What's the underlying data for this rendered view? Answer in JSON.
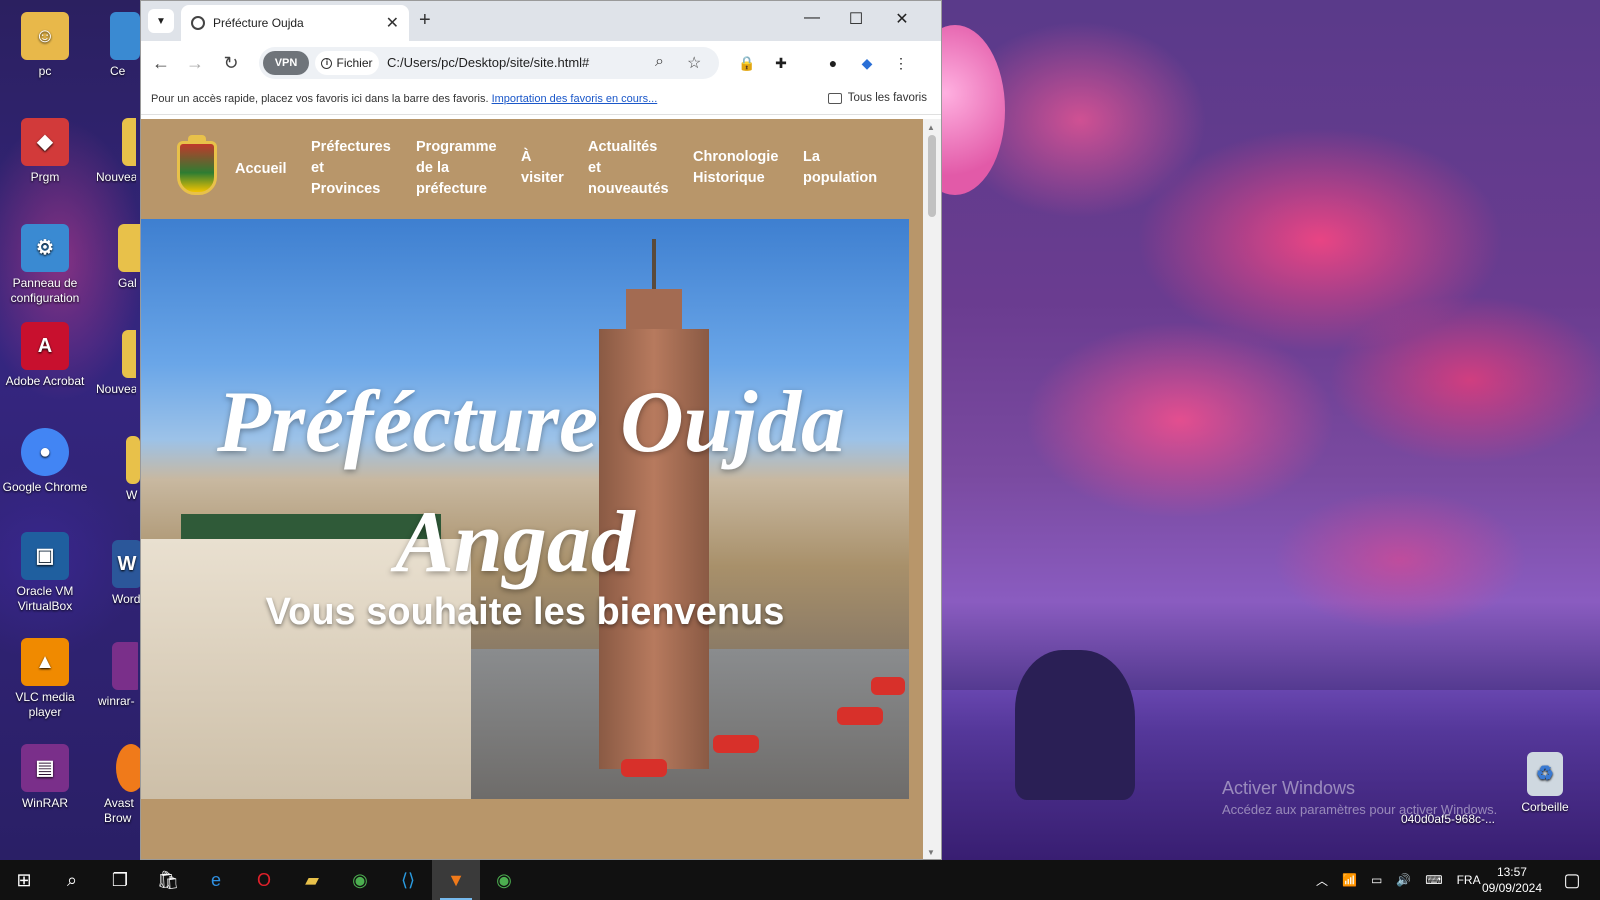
{
  "desktop": {
    "icons": [
      {
        "label": "pc",
        "icon": "user-folder-icon",
        "color": "#e8b84a"
      },
      {
        "label": "Prgm",
        "icon": "programs-icon",
        "color": "#d23a3a"
      },
      {
        "label": "Panneau de configuration",
        "icon": "control-panel-icon",
        "color": "#3a8ad2"
      },
      {
        "label": "Adobe Acrobat",
        "icon": "acrobat-icon",
        "color": "#c8102e"
      },
      {
        "label": "Google Chrome",
        "icon": "chrome-icon",
        "color": "#4285f4"
      },
      {
        "label": "Oracle VM VirtualBox",
        "icon": "virtualbox-icon",
        "color": "#1f5f9f"
      },
      {
        "label": "VLC media player",
        "icon": "vlc-icon",
        "color": "#f08a00"
      },
      {
        "label": "WinRAR",
        "icon": "winrar-icon",
        "color": "#7a2f8a"
      }
    ],
    "partial_icons": [
      {
        "label": "Ce",
        "icon": "computer-icon",
        "color": "#3a8ad2"
      },
      {
        "label": "Nouveau",
        "icon": "folder-icon",
        "color": "#e8c14a"
      },
      {
        "label": "Gal",
        "icon": "folder-icon",
        "color": "#e8c14a"
      },
      {
        "label": "Nouveau",
        "icon": "folder-icon",
        "color": "#e8c14a"
      },
      {
        "label": "W",
        "icon": "folder-icon",
        "color": "#e8c14a"
      },
      {
        "label": "Word",
        "icon": "word-icon",
        "color": "#2b579a"
      },
      {
        "label": "winrar-",
        "icon": "winrar-icon",
        "color": "#7a2f8a"
      },
      {
        "label": "Avast Brow",
        "icon": "avast-icon",
        "color": "#f07a1a"
      }
    ],
    "recycle_bin": "Corbeille",
    "file_label": "040d0af5-968c-...",
    "watermark": {
      "title": "Activer Windows",
      "subtitle": "Accédez aux paramètres pour activer Windows."
    }
  },
  "browser": {
    "tab_title": "Préfécture Oujda",
    "chip_vpn": "VPN",
    "chip_file": "Fichier",
    "url": "C:/Users/pc/Desktop/site/site.html#",
    "bookmarks_text": "Pour un accès rapide, placez vos favoris ici dans la barre des favoris.",
    "bookmarks_link": "Importation des favoris en cours...",
    "all_favorites": "Tous les favoris"
  },
  "site": {
    "nav": [
      {
        "lines": [
          "Accueil"
        ]
      },
      {
        "lines": [
          "Préfectures",
          "et",
          "Provinces"
        ]
      },
      {
        "lines": [
          "Programme",
          "de la",
          "préfecture"
        ]
      },
      {
        "lines": [
          "À",
          "visiter"
        ]
      },
      {
        "lines": [
          "Actualités",
          "et",
          "nouveautés"
        ]
      },
      {
        "lines": [
          "Chronologie",
          "Historique"
        ]
      },
      {
        "lines": [
          "La",
          "population"
        ]
      }
    ],
    "hero_title_line1": "Préfécture Oujda",
    "hero_title_line2": "Angad",
    "hero_subtitle": "Vous souhaite les bienvenus",
    "nav_background": "#b8966a"
  },
  "taskbar": {
    "language": "FRA",
    "time": "13:57",
    "date": "09/09/2024",
    "apps": [
      "start-icon",
      "search-icon",
      "task-view-icon",
      "store-icon",
      "edge-icon",
      "opera-icon",
      "file-explorer-icon",
      "chrome-icon",
      "vscode-icon",
      "brave-icon",
      "chrome-profile-icon"
    ]
  }
}
